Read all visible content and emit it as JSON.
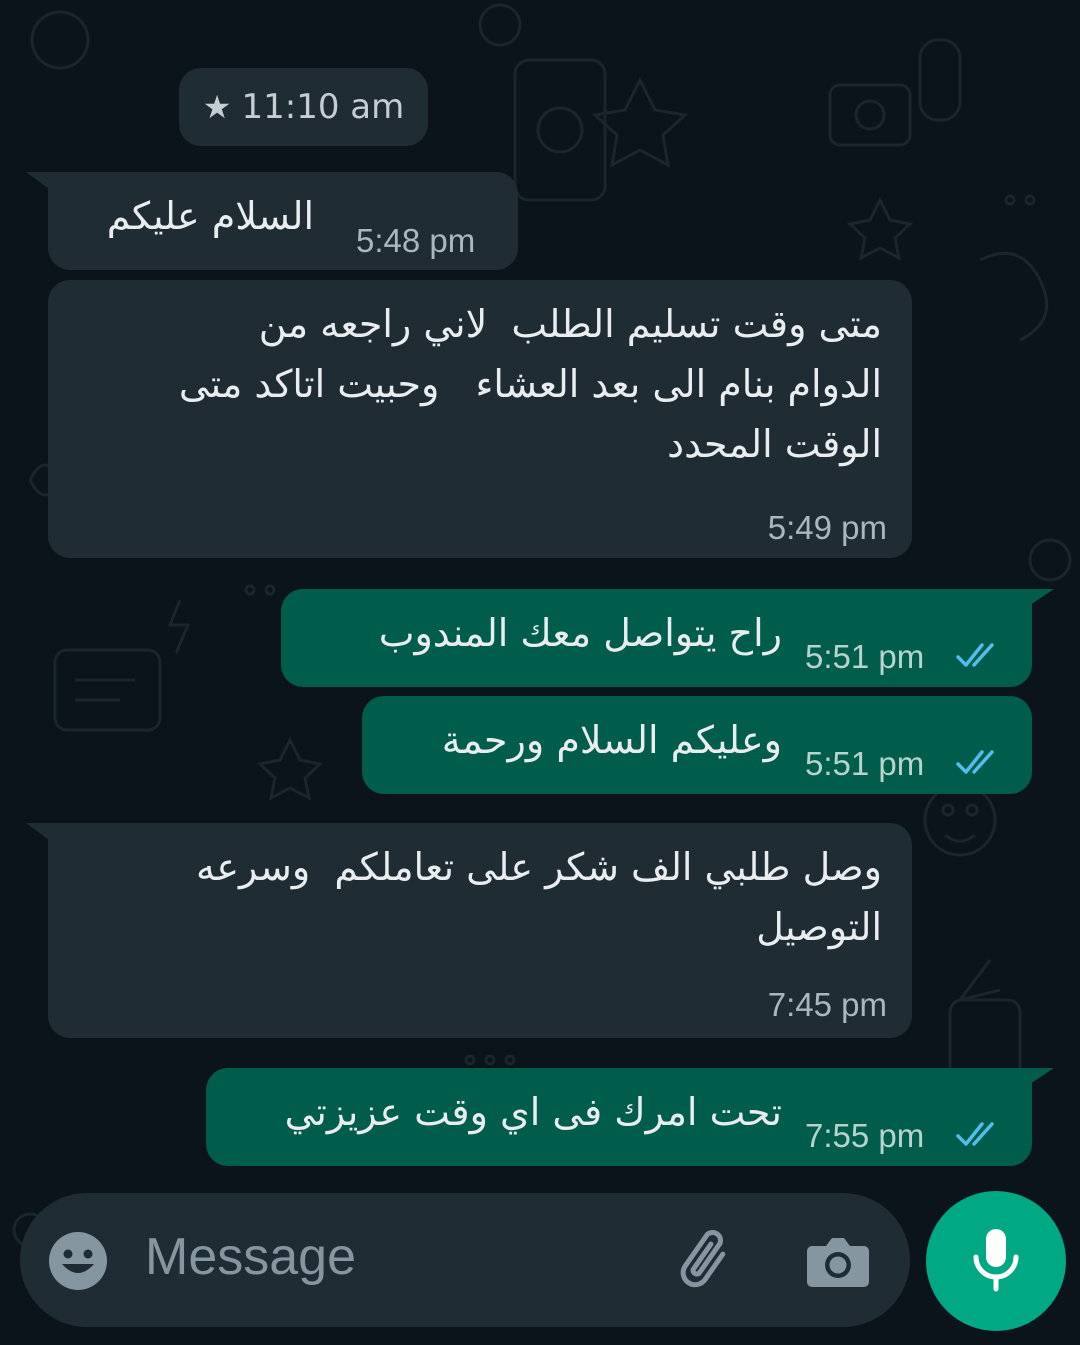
{
  "date_chip": {
    "text": "11:10 am",
    "icon": "star-icon"
  },
  "messages": [
    {
      "direction": "incoming",
      "text": "السلام عليكم",
      "time": "5:48 pm"
    },
    {
      "direction": "incoming",
      "text": "متى وقت تسليم الطلب  لاني راجعه من\nالدوام بنام الى بعد العشاء   وحبيت اتاكد متى\nالوقت المحدد",
      "time": "5:49 pm"
    },
    {
      "direction": "outgoing",
      "text": "راح يتواصل معك المندوب",
      "time": "5:51 pm",
      "status": "read"
    },
    {
      "direction": "outgoing",
      "text": "وعليكم السلام ورحمة",
      "time": "5:51 pm",
      "status": "read"
    },
    {
      "direction": "incoming",
      "text": "وصل طلبي الف شكر على تعاملكم  وسرعه\nالتوصيل",
      "time": "7:45 pm"
    },
    {
      "direction": "outgoing",
      "text": "تحت امرك فى اي وقت عزيزتي",
      "time": "7:55 pm",
      "status": "read"
    }
  ],
  "composer": {
    "placeholder": "Message",
    "icons": [
      "emoji-icon",
      "paperclip-icon",
      "camera-icon",
      "microphone-icon"
    ]
  },
  "colors": {
    "background": "#0b141a",
    "incoming_bubble": "#1f2c34",
    "outgoing_bubble": "#005c4b",
    "accent": "#00a884",
    "read_ticks": "#53bdeb"
  }
}
